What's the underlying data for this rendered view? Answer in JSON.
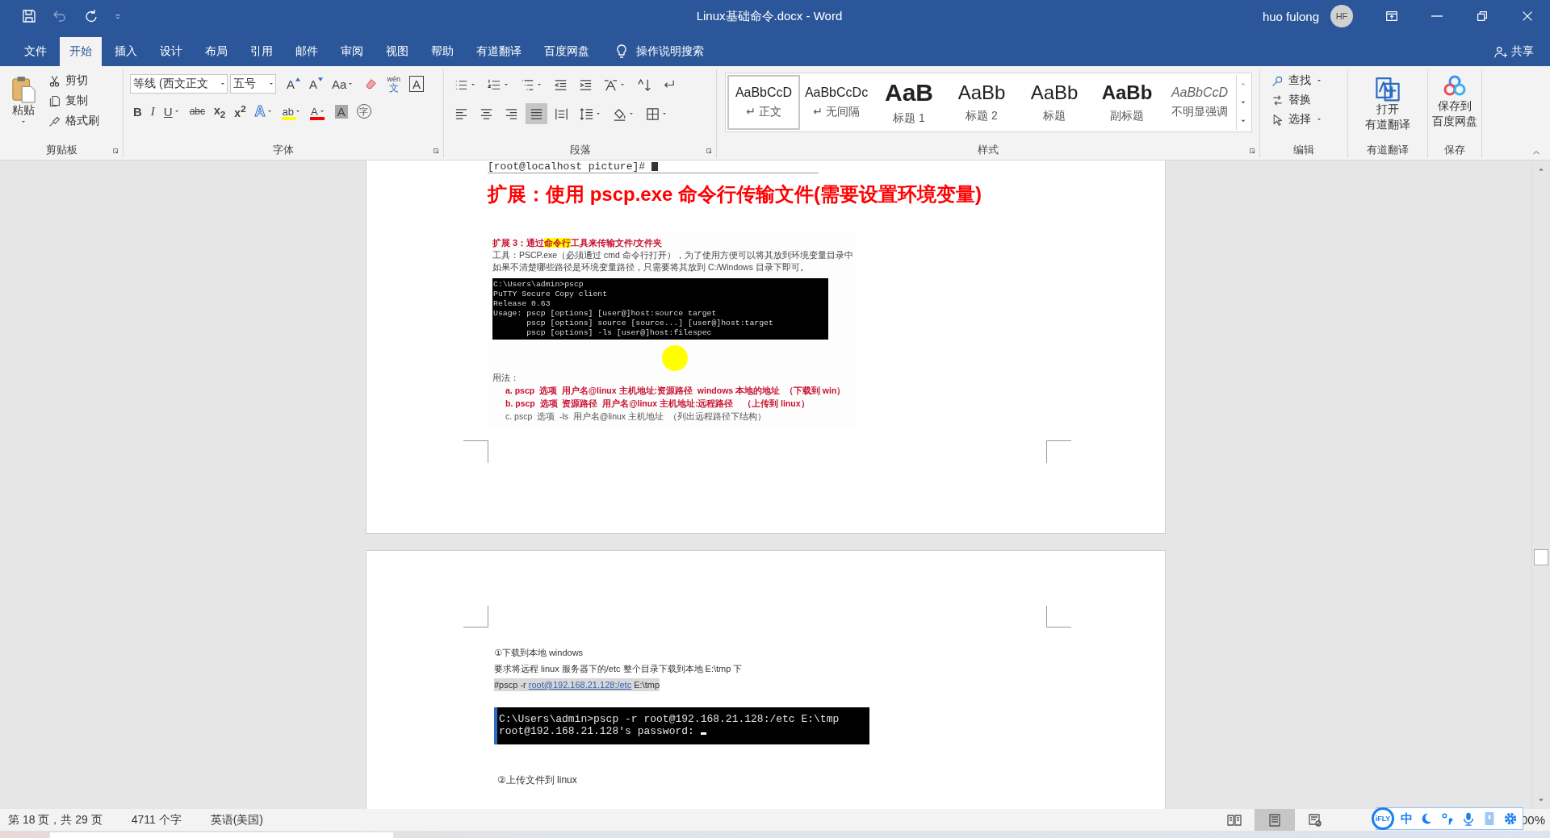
{
  "window": {
    "title": "Linux基础命令.docx - Word",
    "user": "huo fulong",
    "avatar": "HF"
  },
  "quick_access": [
    {
      "kind": "save",
      "disabled": false
    },
    {
      "kind": "undo",
      "disabled": true
    },
    {
      "kind": "redo",
      "disabled": false
    },
    {
      "kind": "customize",
      "disabled": false
    }
  ],
  "tabs": [
    {
      "label": "文件",
      "selected": false
    },
    {
      "label": "开始",
      "selected": true
    },
    {
      "label": "插入",
      "selected": false
    },
    {
      "label": "设计",
      "selected": false
    },
    {
      "label": "布局",
      "selected": false
    },
    {
      "label": "引用",
      "selected": false
    },
    {
      "label": "邮件",
      "selected": false
    },
    {
      "label": "审阅",
      "selected": false
    },
    {
      "label": "视图",
      "selected": false
    },
    {
      "label": "帮助",
      "selected": false
    },
    {
      "label": "有道翻译",
      "selected": false
    },
    {
      "label": "百度网盘",
      "selected": false
    }
  ],
  "tell_me": "操作说明搜索",
  "share": "共享",
  "ribbon": {
    "clipboard": {
      "group": "剪贴板",
      "paste": "粘贴",
      "items": [
        {
          "kind": "cut",
          "label": "剪切"
        },
        {
          "kind": "copy",
          "label": "复制"
        },
        {
          "kind": "painter",
          "label": "格式刷"
        }
      ]
    },
    "font": {
      "group": "字体",
      "name": "等线 (西文正文",
      "size": "五号",
      "row1": [
        {
          "kind": "grow",
          "label": "A",
          "dropdown": false
        },
        {
          "kind": "shrink",
          "label": "A",
          "dropdown": false
        },
        {
          "kind": "case",
          "label": "Aa",
          "dropdown": true
        },
        {
          "kind": "clear",
          "dropdown": false
        },
        {
          "kind": "pinyin",
          "top": "wén",
          "label": "文",
          "dropdown": false
        },
        {
          "kind": "border",
          "label": "A",
          "dropdown": false
        }
      ],
      "row2": [
        {
          "kind": "bold",
          "label": "B",
          "dropdown": false
        },
        {
          "kind": "italic",
          "label": "I",
          "dropdown": false
        },
        {
          "kind": "underline",
          "label": "U",
          "dropdown": true
        },
        {
          "kind": "strike",
          "label": "abc",
          "dropdown": false
        },
        {
          "kind": "script",
          "label": "x$_{2}$",
          "dropdown": false
        },
        {
          "kind": "script",
          "label": "x$^{2}$",
          "dropdown": false
        },
        {
          "kind": "effects",
          "label": "A",
          "dropdown": true
        },
        {
          "kind": "colorbar",
          "label": "ab",
          "color": "#ffff00",
          "dropdown": true
        },
        {
          "kind": "colorbar",
          "label": "A",
          "color": "#ff0000",
          "dropdown": true
        },
        {
          "kind": "shading",
          "label": "A",
          "dropdown": false
        },
        {
          "kind": "enclose",
          "label": "字",
          "dropdown": false
        }
      ]
    },
    "paragraph": {
      "group": "段落",
      "row1": [
        {
          "kind": "bullets",
          "dropdown": true
        },
        {
          "kind": "numbering",
          "dropdown": true
        },
        {
          "kind": "multilevel",
          "dropdown": true
        },
        {
          "kind": "outdent",
          "dropdown": false
        },
        {
          "kind": "indent",
          "dropdown": false
        },
        {
          "kind": "asian",
          "dropdown": true
        },
        {
          "kind": "sort",
          "dropdown": false
        },
        {
          "kind": "marks",
          "dropdown": false
        }
      ],
      "align": [
        {
          "kind": "left",
          "selected": false
        },
        {
          "kind": "center",
          "selected": false
        },
        {
          "kind": "right",
          "selected": false
        },
        {
          "kind": "justify",
          "selected": true
        },
        {
          "kind": "distributed",
          "selected": false
        }
      ],
      "row2": [
        {
          "kind": "spacing",
          "dropdown": true
        },
        {
          "kind": "shade",
          "dropdown": true
        },
        {
          "kind": "borders",
          "dropdown": true
        }
      ]
    },
    "styles": {
      "group": "样式",
      "items": [
        {
          "kind": "normal",
          "sample": "AaBbCcD",
          "label": "↵ 正文",
          "selected": true
        },
        {
          "kind": "normal",
          "sample": "AaBbCcDc",
          "label": "↵ 无间隔",
          "selected": false
        },
        {
          "kind": "h1",
          "sample": "AaB",
          "label": "标题 1",
          "selected": false
        },
        {
          "kind": "h2",
          "sample": "AaBb",
          "label": "标题 2",
          "selected": false
        },
        {
          "kind": "h2",
          "sample": "AaBb",
          "label": "标题",
          "selected": false
        },
        {
          "kind": "subtitle",
          "sample": "AaBb",
          "label": "副标题",
          "selected": false
        },
        {
          "kind": "subtle",
          "sample": "AaBbCcD",
          "label": "不明显强调",
          "selected": false
        }
      ]
    },
    "editing": {
      "group": "编辑",
      "items": [
        {
          "kind": "find",
          "label": "查找",
          "dropdown": true
        },
        {
          "kind": "replace",
          "label": "替换",
          "dropdown": false
        },
        {
          "kind": "select",
          "label": "选择",
          "dropdown": true
        }
      ]
    },
    "youdao": {
      "group": "有道翻译",
      "label": [
        "打开",
        "有道翻译"
      ]
    },
    "baidu": {
      "group": "保存",
      "label": [
        "保存到",
        "百度网盘"
      ]
    }
  },
  "document": {
    "cut_line": "[root@localhost picture]#",
    "heading": "扩展：使用 pscp.exe 命令行传输文件(需要设置环境变量)",
    "figure1": {
      "title": [
        {
          "text": "扩展 3：通过",
          "highlight": false
        },
        {
          "text": "命令行",
          "highlight": true
        },
        {
          "text": "工具来传输文件/文件夹",
          "highlight": false
        }
      ],
      "intro": [
        "工具：PSCP.exe（必须通过 cmd 命令行打开），为了使用方便可以将其放到环境变量目录中",
        "如果不清楚哪些路径是环境变量路径，只需要将其放到 C:/Windows 目录下即可。"
      ],
      "terminal": [
        "C:\\Users\\admin>pscp",
        "PuTTY Secure Copy client",
        "Release 0.63",
        "Usage: pscp [options] [user@]host:source target",
        "       pscp [options] source [source...] [user@]host:target",
        "       pscp [options] -ls [user@]host:filespec"
      ],
      "usage_label": "用法：",
      "usage": [
        {
          "kind": "emphasis",
          "text": "a. pscp  选项  用户名@linux 主机地址:资源路径  windows 本地的地址  （下载到 win）"
        },
        {
          "kind": "emphasis",
          "text": "b. pscp  选项  资源路径  用户名@linux 主机地址:远程路径    （上传到 linux）"
        },
        {
          "kind": "plain",
          "text": "c. pscp  选项  -ls  用户名@linux 主机地址  （列出远程路径下结构）"
        }
      ]
    },
    "figure2": {
      "lines": [
        "①下载到本地 windows",
        "要求将远程 linux 服务器下的/etc 整个目录下载到本地 E:\\tmp 下"
      ],
      "command": {
        "before": "#pscp -r ",
        "link": "root@192.168.21.128:/etc",
        "after": " E:\\tmp"
      },
      "terminal": [
        "C:\\Users\\admin>pscp -r root@192.168.21.128:/etc E:\\tmp",
        "root@192.168.21.128's password:"
      ],
      "next": "②上传文件到 linux"
    }
  },
  "status": {
    "page": "第 18 页，共 29 页",
    "words": "4711 个字",
    "language": "英语(美国)",
    "views": [
      {
        "kind": "read",
        "selected": false
      },
      {
        "kind": "print",
        "selected": true
      },
      {
        "kind": "web",
        "selected": false
      }
    ],
    "zoom": "00%"
  },
  "ime": {
    "logo": "iFLY",
    "mode": "中"
  }
}
